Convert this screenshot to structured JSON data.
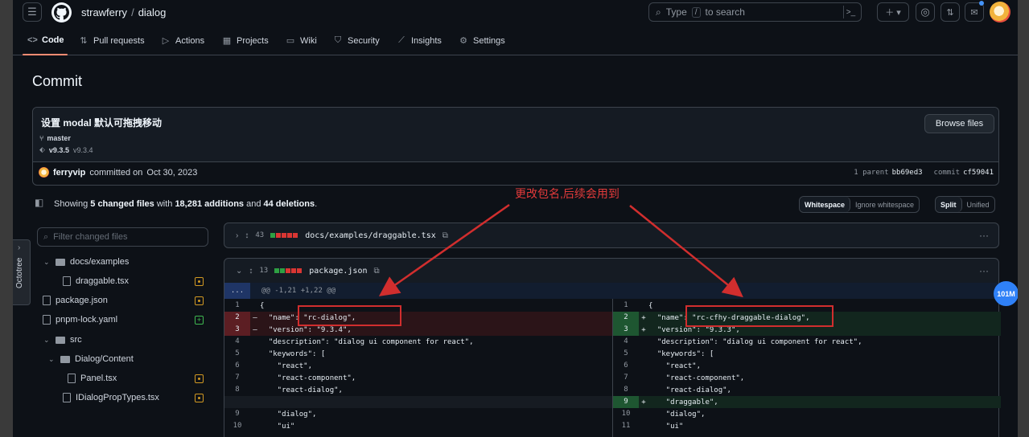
{
  "repo": {
    "owner": "strawferry",
    "name": "dialog",
    "sep": "/"
  },
  "search": {
    "pre": "Type",
    "key": "/",
    "post": "to search"
  },
  "nav": [
    {
      "label": "Code",
      "icon": "code-icon"
    },
    {
      "label": "Pull requests",
      "icon": "pull-request-icon"
    },
    {
      "label": "Actions",
      "icon": "play-icon"
    },
    {
      "label": "Projects",
      "icon": "table-icon"
    },
    {
      "label": "Wiki",
      "icon": "book-icon"
    },
    {
      "label": "Security",
      "icon": "shield-icon"
    },
    {
      "label": "Insights",
      "icon": "graph-icon"
    },
    {
      "label": "Settings",
      "icon": "gear-icon"
    }
  ],
  "page_title": "Commit",
  "commit": {
    "message": "设置 modal 默认可拖拽移动",
    "branch": "master",
    "tag_current": "v9.3.5",
    "tag_prev": "v9.3.4",
    "browse_label": "Browse files",
    "author": "ferryvip",
    "committed": "committed on",
    "date": "Oct 30, 2023",
    "parent_label": "1 parent",
    "parent_sha": "bb69ed3",
    "commit_label": "commit",
    "commit_sha": "cf59041"
  },
  "summary": {
    "showing": "Showing",
    "files": "5 changed files",
    "with": "with",
    "additions": "18,281 additions",
    "and": "and",
    "deletions": "44 deletions",
    "end": "."
  },
  "toggles": {
    "whitespace": "Whitespace",
    "ignore": "Ignore whitespace",
    "split": "Split",
    "unified": "Unified"
  },
  "filter_placeholder": "Filter changed files",
  "tree": {
    "docs_examples": "docs/examples",
    "draggable": "draggable.tsx",
    "package": "package.json",
    "pnpm": "pnpm-lock.yaml",
    "src": "src",
    "dialog_content": "Dialog/Content",
    "panel": "Panel.tsx",
    "idialog": "IDialogPropTypes.tsx"
  },
  "octotree_label": "Octotree",
  "files": [
    {
      "count": "43",
      "name": "docs/examples/draggable.tsx"
    },
    {
      "count": "13",
      "name": "package.json"
    }
  ],
  "hunk": {
    "expand": "...",
    "header": "@@ -1,21 +1,22 @@"
  },
  "left": [
    {
      "n": "1",
      "m": "",
      "c": "{"
    },
    {
      "n": "2",
      "m": "–",
      "c": "  \"name\": \"rc-dialog\","
    },
    {
      "n": "3",
      "m": "–",
      "c": "  \"version\": \"9.3.4\","
    },
    {
      "n": "4",
      "m": "",
      "c": "  \"description\": \"dialog ui component for react\","
    },
    {
      "n": "5",
      "m": "",
      "c": "  \"keywords\": ["
    },
    {
      "n": "6",
      "m": "",
      "c": "    \"react\","
    },
    {
      "n": "7",
      "m": "",
      "c": "    \"react-component\","
    },
    {
      "n": "8",
      "m": "",
      "c": "    \"react-dialog\","
    },
    {
      "n": "",
      "m": "",
      "c": ""
    },
    {
      "n": "9",
      "m": "",
      "c": "    \"dialog\","
    },
    {
      "n": "10",
      "m": "",
      "c": "    \"ui\""
    }
  ],
  "right": [
    {
      "n": "1",
      "m": "",
      "c": "{"
    },
    {
      "n": "2",
      "m": "+",
      "c": "  \"name\": \"rc-cfhy-draggable-dialog\","
    },
    {
      "n": "3",
      "m": "+",
      "c": "  \"version\": \"9.3.3\","
    },
    {
      "n": "4",
      "m": "",
      "c": "  \"description\": \"dialog ui component for react\","
    },
    {
      "n": "5",
      "m": "",
      "c": "  \"keywords\": ["
    },
    {
      "n": "6",
      "m": "",
      "c": "    \"react\","
    },
    {
      "n": "7",
      "m": "",
      "c": "    \"react-component\","
    },
    {
      "n": "8",
      "m": "",
      "c": "    \"react-dialog\","
    },
    {
      "n": "9",
      "m": "+",
      "c": "    \"draggable\","
    },
    {
      "n": "10",
      "m": "",
      "c": "    \"dialog\","
    },
    {
      "n": "11",
      "m": "",
      "c": "    \"ui\""
    }
  ],
  "annotation": "更改包名,后续会用到",
  "float_badge": "101M",
  "colors": {
    "accent": "#fd8c73",
    "annotation": "#e23a3a",
    "add": "#2ea043",
    "del": "#da3633"
  }
}
